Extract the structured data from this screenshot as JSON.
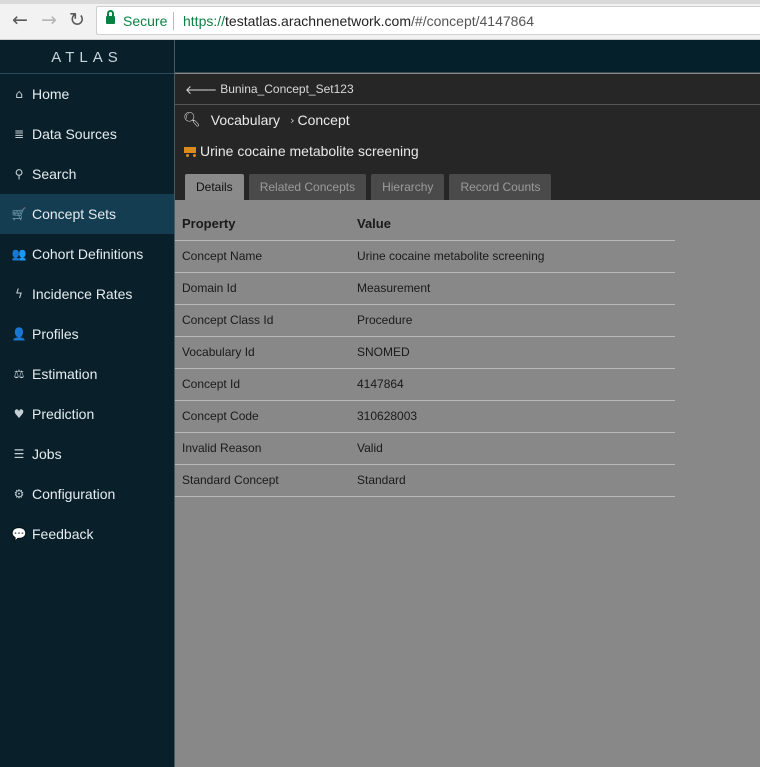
{
  "browser": {
    "back_icon": "←",
    "forward_icon": "→",
    "reload_icon": "↻",
    "secure_label": "Secure",
    "url_scheme": "https://",
    "url_host": "testatlas.arachnenetwork.com",
    "url_path": "/#/concept/4147864"
  },
  "app": {
    "brand": "ATLAS"
  },
  "sidebar": {
    "items": [
      {
        "label": "Home",
        "icon": "⌂",
        "icon_name": "home-icon"
      },
      {
        "label": "Data Sources",
        "icon": "≣",
        "icon_name": "database-icon"
      },
      {
        "label": "Search",
        "icon": "⚲",
        "icon_name": "search-icon"
      },
      {
        "label": "Concept Sets",
        "icon": "🛒",
        "icon_name": "cart-icon"
      },
      {
        "label": "Cohort Definitions",
        "icon": "👥",
        "icon_name": "users-icon"
      },
      {
        "label": "Incidence Rates",
        "icon": "ϟ",
        "icon_name": "bolt-icon"
      },
      {
        "label": "Profiles",
        "icon": "👤",
        "icon_name": "user-icon"
      },
      {
        "label": "Estimation",
        "icon": "⚖",
        "icon_name": "balance-scale-icon"
      },
      {
        "label": "Prediction",
        "icon": "♥",
        "icon_name": "heartbeat-icon"
      },
      {
        "label": "Jobs",
        "icon": "☰",
        "icon_name": "tasks-icon"
      },
      {
        "label": "Configuration",
        "icon": "⚙",
        "icon_name": "cogs-icon"
      },
      {
        "label": "Feedback",
        "icon": "💬",
        "icon_name": "comment-icon"
      }
    ],
    "active_index": 3
  },
  "header": {
    "back_link": "Bunina_Concept_Set123",
    "breadcrumb_vocabulary": "Vocabulary",
    "breadcrumb_concept": "Concept",
    "title": "Urine cocaine metabolite screening",
    "tabs": [
      "Details",
      "Related Concepts",
      "Hierarchy",
      "Record Counts"
    ],
    "active_tab": 0
  },
  "table": {
    "headers": [
      "Property",
      "Value"
    ],
    "rows": [
      [
        "Concept Name",
        "Urine cocaine metabolite screening"
      ],
      [
        "Domain Id",
        "Measurement"
      ],
      [
        "Concept Class Id",
        "Procedure"
      ],
      [
        "Vocabulary Id",
        "SNOMED"
      ],
      [
        "Concept Id",
        "4147864"
      ],
      [
        "Concept Code",
        "310628003"
      ],
      [
        "Invalid Reason",
        "Valid"
      ],
      [
        "Standard Concept",
        "Standard"
      ]
    ]
  },
  "colors": {
    "sidebar_bg": "#09202b",
    "sidebar_active": "#143d52",
    "header_bg": "#262626",
    "content_bg": "#888888",
    "cart_accent": "#d98b1e",
    "secure_green": "#0b8043"
  }
}
